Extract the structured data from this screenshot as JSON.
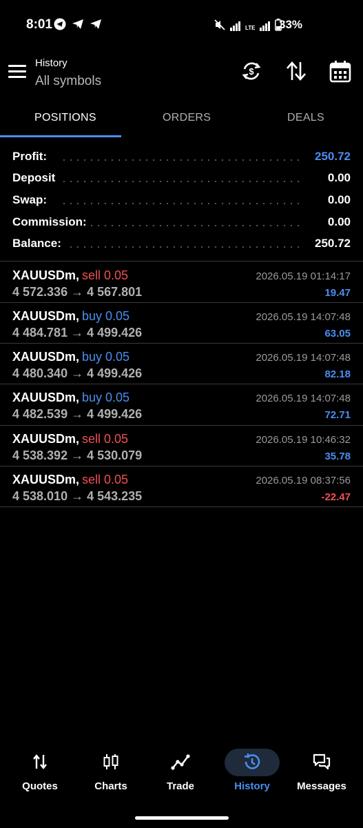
{
  "status": {
    "time": "8:01",
    "battery": "33%",
    "net": "LTE"
  },
  "toolbar": {
    "title": "History",
    "subtitle": "All symbols"
  },
  "tabs": [
    "POSITIONS",
    "ORDERS",
    "DEALS"
  ],
  "summary": [
    {
      "label": "Profit:",
      "value": "250.72",
      "accent": true
    },
    {
      "label": "Deposit",
      "value": "0.00",
      "accent": false
    },
    {
      "label": "Swap:",
      "value": "0.00",
      "accent": false
    },
    {
      "label": "Commission:",
      "value": "0.00",
      "accent": false
    },
    {
      "label": "Balance:",
      "value": "250.72",
      "accent": false
    }
  ],
  "deals": [
    {
      "symbol": "XAUUSDm,",
      "type": "sell",
      "volume": "0.05",
      "prices": "4 572.336 → 4 567.801",
      "time": "2026.05.19 01:14:17",
      "profit": "19.47"
    },
    {
      "symbol": "XAUUSDm,",
      "type": "buy",
      "volume": "0.05",
      "prices": "4 484.781 → 4 499.426",
      "time": "2026.05.19 14:07:48",
      "profit": "63.05"
    },
    {
      "symbol": "XAUUSDm,",
      "type": "buy",
      "volume": "0.05",
      "prices": "4 480.340 → 4 499.426",
      "time": "2026.05.19 14:07:48",
      "profit": "82.18"
    },
    {
      "symbol": "XAUUSDm,",
      "type": "buy",
      "volume": "0.05",
      "prices": "4 482.539 → 4 499.426",
      "time": "2026.05.19 14:07:48",
      "profit": "72.71"
    },
    {
      "symbol": "XAUUSDm,",
      "type": "sell",
      "volume": "0.05",
      "prices": "4 538.392 → 4 530.079",
      "time": "2026.05.19 10:46:32",
      "profit": "35.78"
    },
    {
      "symbol": "XAUUSDm,",
      "type": "sell",
      "volume": "0.05",
      "prices": "4 538.010 → 4 543.235",
      "time": "2026.05.19 08:37:56",
      "profit": "-22.47"
    }
  ],
  "nav": [
    {
      "label": "Quotes",
      "icon": "quotes-icon"
    },
    {
      "label": "Charts",
      "icon": "charts-icon"
    },
    {
      "label": "Trade",
      "icon": "trade-icon"
    },
    {
      "label": "History",
      "icon": "history-icon",
      "active": true
    },
    {
      "label": "Messages",
      "icon": "messages-icon"
    }
  ],
  "colors": {
    "accent": "#4a8ef0",
    "sell": "#f05050",
    "muted": "#9a9a9a"
  }
}
